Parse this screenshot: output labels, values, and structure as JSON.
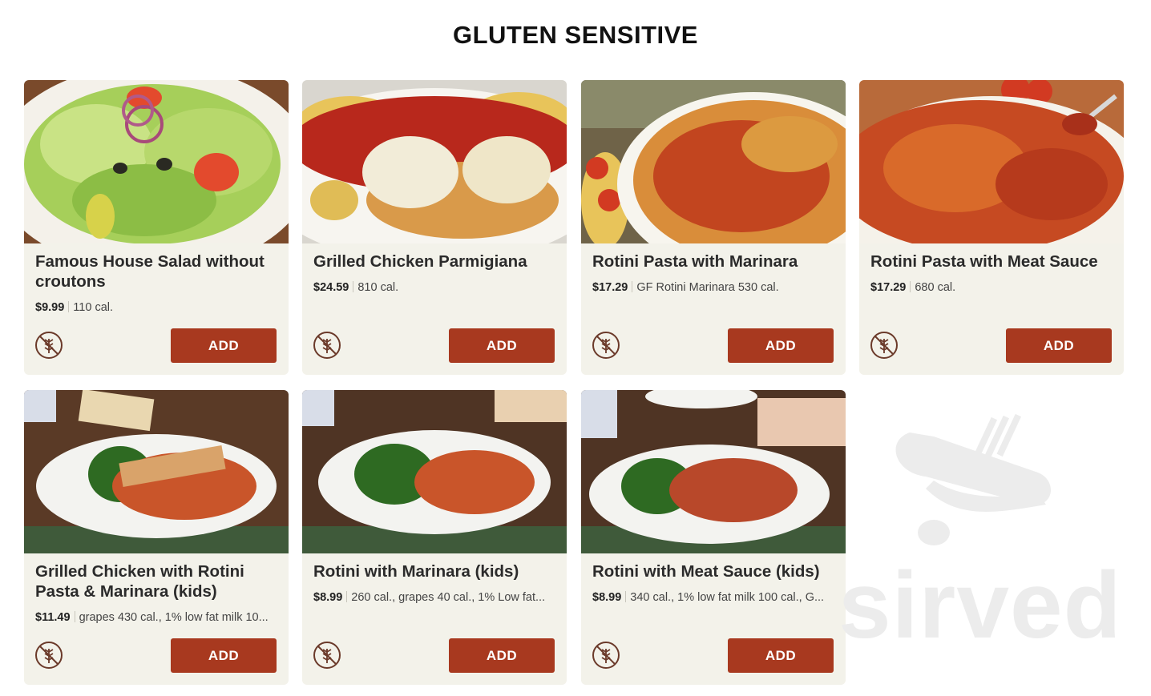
{
  "section": {
    "title": "GLUTEN SENSITIVE"
  },
  "buttons": {
    "add_label": "ADD"
  },
  "icons": {
    "gluten_free": "gluten-free-icon"
  },
  "colors": {
    "accent": "#a8391f",
    "card_bg": "#f3f2ea"
  },
  "items": [
    {
      "name": "Famous House Salad without croutons",
      "price": "$9.99",
      "details": "110 cal."
    },
    {
      "name": "Grilled Chicken Parmigiana",
      "price": "$24.59",
      "details": "810 cal."
    },
    {
      "name": "Rotini Pasta with Marinara",
      "price": "$17.29",
      "details": "GF Rotini Marinara 530 cal."
    },
    {
      "name": "Rotini Pasta with Meat Sauce",
      "price": "$17.29",
      "details": "680 cal."
    },
    {
      "name": "Grilled Chicken with Rotini Pasta & Marinara (kids)",
      "price": "$11.49",
      "details": "grapes 430 cal., 1% low fat milk 10..."
    },
    {
      "name": "Rotini with Marinara (kids)",
      "price": "$8.99",
      "details": "260 cal., grapes 40 cal., 1% Low fat..."
    },
    {
      "name": "Rotini with Meat Sauce (kids)",
      "price": "$8.99",
      "details": "340 cal., 1% low fat milk 100 cal., G..."
    }
  ],
  "watermark": {
    "text": "sirved"
  }
}
